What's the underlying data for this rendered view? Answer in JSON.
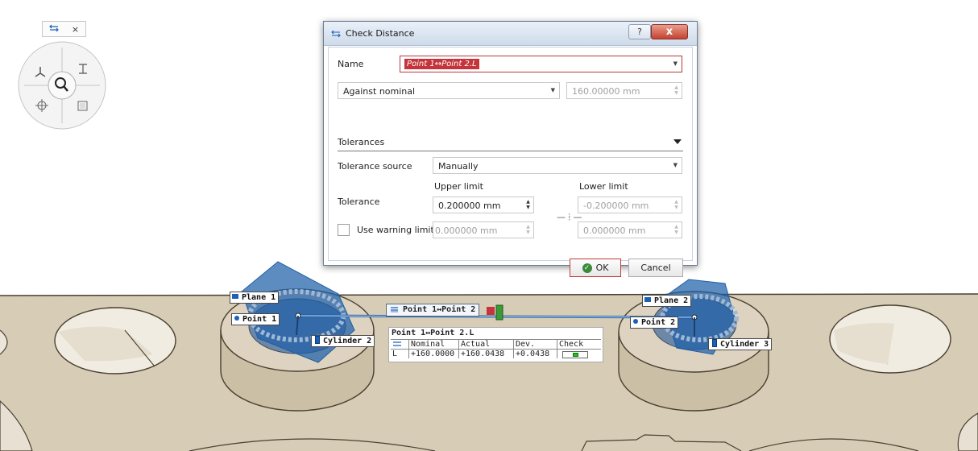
{
  "colors": {
    "plate": "#d7ccb6",
    "plate_shadow": "#b8ab92",
    "plate_edge": "#4a4030",
    "feature_blue": "#1f5fa9",
    "dialog_accent": "#c4343a",
    "check_green": "#22c022"
  },
  "nav": {
    "toolbar_icons": [
      "measure-distance-icon",
      "close-icon"
    ],
    "close_glyph": "×",
    "wheel_icons": [
      "fan-icon",
      "text-tool-icon",
      "zoom-icon",
      "pan-icon",
      "frame-icon"
    ]
  },
  "dialog": {
    "title": "Check Distance",
    "help_glyph": "?",
    "close_glyph": "x",
    "name_label": "Name",
    "name_value": "Point 1↔Point 2.L",
    "mode_value": "Against nominal",
    "nominal_value": "160.00000 mm",
    "tolerances_header": "Tolerances",
    "tolerance_source_label": "Tolerance source",
    "tolerance_source_value": "Manually",
    "upper_limit_label": "Upper limit",
    "lower_limit_label": "Lower limit",
    "tolerance_label": "Tolerance",
    "upper_value": "0.200000 mm",
    "lower_value": "-0.200000 mm",
    "warning_checkbox_label": "Use warning limit",
    "warning_upper_value": "0.000000 mm",
    "warning_lower_value": "0.000000 mm",
    "link_glyph": "— ⦙ —",
    "ok_label": "OK",
    "cancel_label": "Cancel"
  },
  "scene": {
    "labels": {
      "plane1": "Plane 1",
      "point1": "Point 1",
      "cylinder2": "Cylinder 2",
      "plane2": "Plane 2",
      "point2": "Point 2",
      "cylinder3": "Cylinder 3",
      "distance": "Point 1↔Point 2"
    },
    "result": {
      "title": "Point 1↔Point 2.L",
      "headers": [
        "",
        "Nominal",
        "Actual",
        "Dev.",
        "Check"
      ],
      "row": [
        "L",
        "+160.0000",
        "+160.0438",
        "+0.0438"
      ],
      "check_level": 0.5
    }
  }
}
